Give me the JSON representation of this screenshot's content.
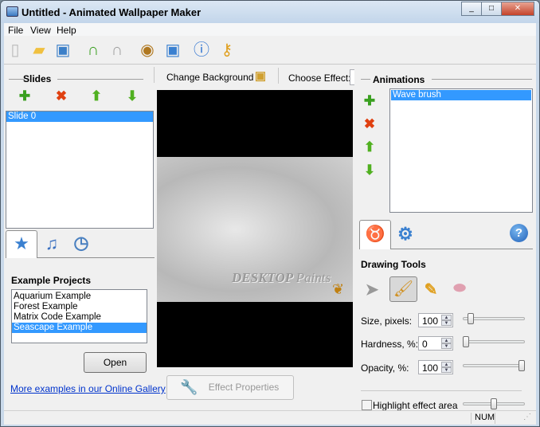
{
  "window": {
    "title": "Untitled - Animated Wallpaper Maker",
    "minimize": "_",
    "maximize": "□",
    "close": "✕"
  },
  "menu": [
    "File",
    "View",
    "Help"
  ],
  "toolbar": [
    {
      "icon": "new-file-icon",
      "glyph": "▯",
      "color": "#bbbbbb"
    },
    {
      "icon": "open-folder-icon",
      "glyph": "▰",
      "color": "#f0c040"
    },
    {
      "icon": "save-icon",
      "glyph": "▣",
      "color": "#3b7fc8"
    },
    {
      "icon": "undo-icon",
      "glyph": "∩",
      "color": "#3aa020"
    },
    {
      "icon": "redo-icon",
      "glyph": "∩",
      "color": "#a0a0a0"
    },
    {
      "icon": "preview-eye-icon",
      "glyph": "◉",
      "color": "#b07820"
    },
    {
      "icon": "set-wallpaper-icon",
      "glyph": "▣",
      "color": "#3a80d0"
    },
    {
      "icon": "info-icon",
      "glyph": "ⓘ",
      "color": "#2a70d0"
    },
    {
      "icon": "key-icon",
      "glyph": "⚷",
      "color": "#e0a020"
    }
  ],
  "slides": {
    "title": "Slides",
    "items": [
      "Slide 0"
    ],
    "selected": 0
  },
  "left_tabs": [
    "favorites-star-icon",
    "music-icon",
    "clock-icon"
  ],
  "examples": {
    "title": "Example Projects",
    "items": [
      "Aquarium Example",
      "Forest Example",
      "Matrix Code Example",
      "Seascape Example"
    ],
    "selected": 3,
    "open_label": "Open",
    "gallery_link": "More examples in our Online Gallery"
  },
  "center": {
    "change_background": "Change Background",
    "choose_effect": "Choose Effect:",
    "watermark": "DESKTOP Paints",
    "effect_properties": "Effect Properties"
  },
  "animations": {
    "title": "Animations",
    "items": [
      "Wave brush"
    ],
    "selected": 0
  },
  "drawing": {
    "title": "Drawing Tools",
    "selected_tool": "brush",
    "size_label": "Size, pixels:",
    "size": "100",
    "size_pct": 0.08,
    "hardness_label": "Hardness, %:",
    "hardness": "0",
    "hardness_pct": 0,
    "opacity_label": "Opacity, %:",
    "opacity": "100",
    "opacity_pct": 1,
    "highlight_label": "Highlight effect area",
    "highlight_checked": false,
    "highlight_pct": 0.5
  },
  "status": {
    "num": "NUM"
  }
}
